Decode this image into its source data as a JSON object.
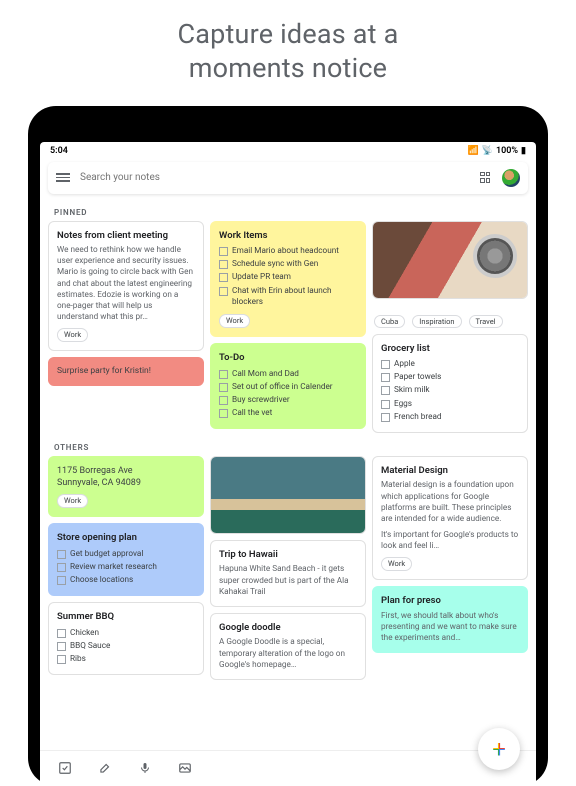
{
  "promo": {
    "line1": "Capture ideas at a",
    "line2": "moments notice"
  },
  "status": {
    "time": "5:04",
    "battery": "100%"
  },
  "search": {
    "placeholder": "Search your notes"
  },
  "sections": {
    "pinned": "PINNED",
    "others": "OTHERS"
  },
  "pinned": {
    "client_meeting": {
      "title": "Notes from client meeting",
      "body": "We need to rethink how we handle user experience and security issues. Mario is going to circle back with Gen and chat about the latest engineering estimates. Edozie is working on a one-pager that will help us understand what this pr…",
      "tag": "Work"
    },
    "surprise": {
      "body": "Surprise party for Kristin!"
    },
    "work_items": {
      "title": "Work Items",
      "items": [
        "Email Mario about headcount",
        "Schedule sync with Gen",
        "Update PR team",
        "Chat with Erin about launch blockers"
      ],
      "tag": "Work"
    },
    "todo": {
      "title": "To-Do",
      "items": [
        "Call Mom and Dad",
        "Set out of office in Calender",
        "Buy screwdriver",
        "Call the vet"
      ]
    },
    "photo_tags": [
      "Cuba",
      "Inspiration",
      "Travel"
    ],
    "grocery": {
      "title": "Grocery list",
      "items": [
        "Apple",
        "Paper towels",
        "Skim milk",
        "Eggs",
        "French bread"
      ]
    }
  },
  "others": {
    "address": {
      "line1": "1175 Borregas Ave",
      "line2": "Sunnyvale, CA 94089",
      "tag": "Work"
    },
    "store": {
      "title": "Store opening plan",
      "items": [
        "Get budget approval",
        "Review market research",
        "Choose locations"
      ]
    },
    "bbq": {
      "title": "Summer BBQ",
      "items": [
        "Chicken",
        "BBQ Sauce",
        "Ribs"
      ]
    },
    "hawaii": {
      "title": "Trip to Hawaii",
      "body": "Hapuna White Sand Beach - it gets super crowded but is part of the Ala Kahakai Trail"
    },
    "doodle": {
      "title": "Google doodle",
      "body": "A Google Doodle is a special, temporary alteration of the logo on Google's homepage…"
    },
    "material": {
      "title": "Material Design",
      "body1": "Material design is a foundation upon which applications for Google platforms are built. These principles are intended for a wide audience.",
      "body2": "It's important for Google's products to look and feel li…",
      "tag": "Work"
    },
    "preso": {
      "title": "Plan for preso",
      "body": "First, we should talk about who's presenting and we want to make sure the experiments and…"
    }
  },
  "bottombar": {
    "checkbox": "checkbox-icon",
    "brush": "brush-icon",
    "mic": "mic-icon",
    "image": "image-icon",
    "fab": "+"
  }
}
